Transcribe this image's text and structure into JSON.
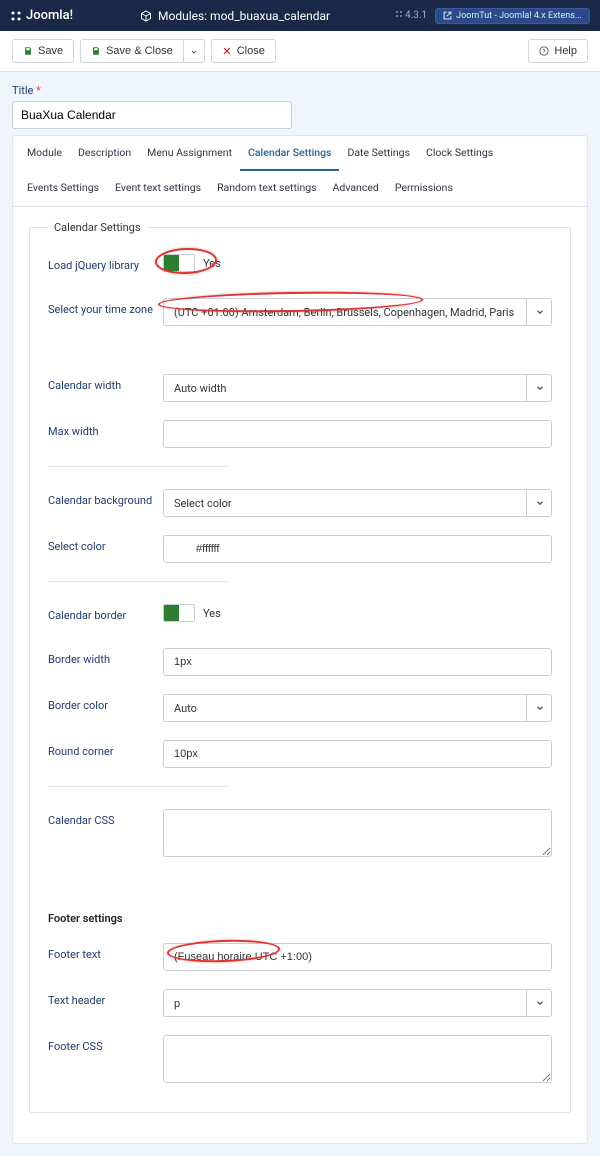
{
  "topbar": {
    "brand": "Joomla!",
    "module_label": "Modules: mod_buaxua_calendar",
    "version_prefix": "4.3.1",
    "extension_label": "JoomTut - Joomla! 4.x Extens..."
  },
  "toolbar": {
    "save": "Save",
    "save_close": "Save & Close",
    "close": "Close",
    "help": "Help"
  },
  "title_field": {
    "label": "Title",
    "star": "*",
    "value": "BuaXua Calendar"
  },
  "tabs": [
    "Module",
    "Description",
    "Menu Assignment",
    "Calendar Settings",
    "Date Settings",
    "Clock Settings",
    "Events Settings",
    "Event text settings",
    "Random text settings",
    "Advanced",
    "Permissions"
  ],
  "tabs_active_index": 3,
  "fieldset_legend": "Calendar Settings",
  "rows": {
    "jquery": {
      "label": "Load jQuery library",
      "value": "Yes"
    },
    "timezone": {
      "label": "Select your time zone",
      "value": "(UTC +01:00) Amsterdam, Berlin, Brussels, Copenhagen, Madrid, Paris"
    },
    "cal_width": {
      "label": "Calendar width",
      "value": "Auto width"
    },
    "max_width": {
      "label": "Max width",
      "value": ""
    },
    "cal_bg": {
      "label": "Calendar background",
      "value": "Select color"
    },
    "select_color": {
      "label": "Select color",
      "value": "#ffffff"
    },
    "cal_border": {
      "label": "Calendar border",
      "value": "Yes"
    },
    "border_width": {
      "label": "Border width",
      "value": "1px"
    },
    "border_color": {
      "label": "Border color",
      "value": "Auto"
    },
    "round_corner": {
      "label": "Round corner",
      "value": "10px"
    },
    "cal_css": {
      "label": "Calendar CSS",
      "value": ""
    },
    "footer_section": "Footer settings",
    "footer_text": {
      "label": "Footer text",
      "value": "(Fuseau horaire UTC +1:00)"
    },
    "text_header": {
      "label": "Text header",
      "value": "p"
    },
    "footer_css": {
      "label": "Footer CSS",
      "value": ""
    }
  }
}
